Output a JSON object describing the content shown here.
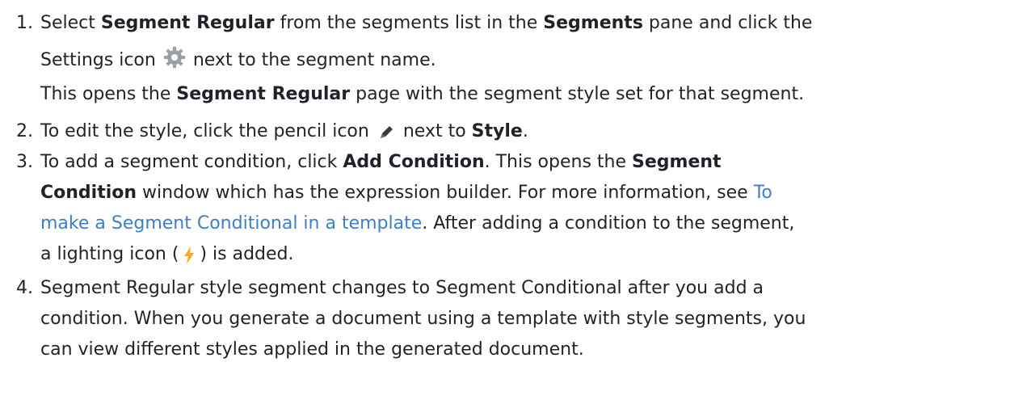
{
  "steps": [
    {
      "num": "1.",
      "l1_a": "Select ",
      "l1_b": "Segment Regular",
      "l1_c": " from the segments list in the ",
      "l1_d": "Segments",
      "l1_e": " pane and click the",
      "l2_a": "Settings icon",
      "l2_icon": "settings-gear-icon",
      "l2_b": "next to the segment name.",
      "l3_a": "This opens the ",
      "l3_b": "Segment Regular",
      "l3_c": " page with the segment style set for that segment."
    },
    {
      "num": "2.",
      "a": "To edit the style, click the pencil icon",
      "icon": "pencil-icon",
      "b": "next to ",
      "c": "Style",
      "d": "."
    },
    {
      "num": "3.",
      "l1_a": "To add a segment condition, click ",
      "l1_b": "Add Condition",
      "l1_c": ". This opens the ",
      "l1_d": "Segment",
      "l2_a": "Condition",
      "l2_b": " window which has the expression builder. For more information, see ",
      "l2_link": "To",
      "l3_link": "make a Segment Conditional in a template",
      "l3_b": ". After adding a condition to the segment,",
      "l4_a": "a lighting icon (",
      "l4_icon": "lightning-bolt-icon",
      "l4_b": ") is added."
    },
    {
      "num": "4.",
      "l1": "Segment Regular style segment changes to Segment Conditional after you add a",
      "l2": "condition. When you generate a document using a template with style segments, you",
      "l3": "can view different styles applied in the generated document."
    }
  ],
  "colors": {
    "text": "#1f2329",
    "link": "#3d7ec9",
    "gear": "#9aa0a6",
    "bolt": "#f5a623"
  }
}
